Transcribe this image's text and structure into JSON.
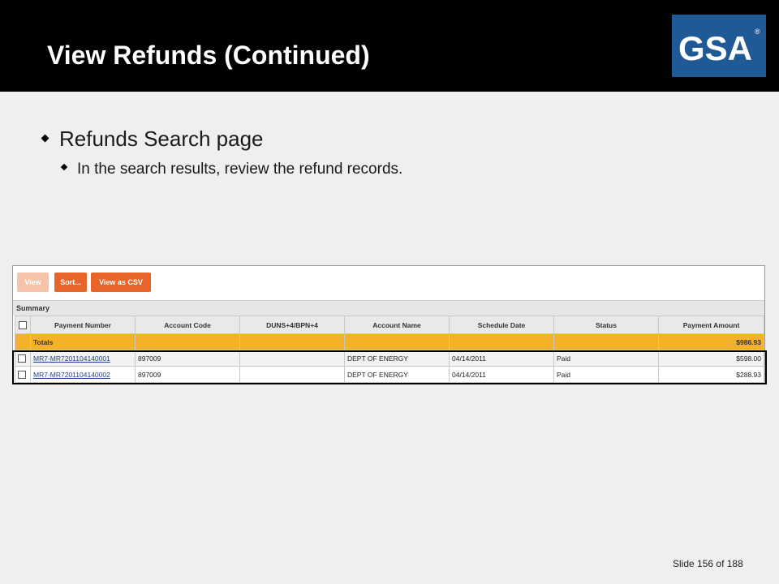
{
  "slide": {
    "title": "View Refunds (Continued)",
    "logo_text": "GSA",
    "logo_mark": "®",
    "bullet1": "Refunds Search page",
    "bullet2": "In the search results, review the refund records.",
    "slide_label": "Slide 156",
    "of_label": "of 188"
  },
  "toolbar": {
    "view_label": "View",
    "sort_label": "Sort...",
    "csv_label": "View as CSV"
  },
  "summary_label": "Summary",
  "table": {
    "columns": [
      "Payment Number",
      "Account Code",
      "DUNS+4/BPN+4",
      "Account Name",
      "Schedule Date",
      "Status",
      "Payment Amount"
    ],
    "totals_label": "Totals",
    "totals_amount": "$986.93",
    "rows": [
      {
        "payment_number": "MR7-MR7201104140001",
        "account_code": "897009",
        "duns": "",
        "account_name": "DEPT OF ENERGY",
        "schedule_date": "04/14/2011",
        "status": "Paid",
        "amount": "$598.00"
      },
      {
        "payment_number": "MR7-MR7201104140002",
        "account_code": "897009",
        "duns": "",
        "account_name": "DEPT OF ENERGY",
        "schedule_date": "04/14/2011",
        "status": "Paid",
        "amount": "$288.93"
      }
    ]
  },
  "colors": {
    "header_bg": "#000000",
    "logo_bg": "#1f5a96",
    "button_orange": "#e8652a",
    "totals_row": "#f4b228"
  }
}
